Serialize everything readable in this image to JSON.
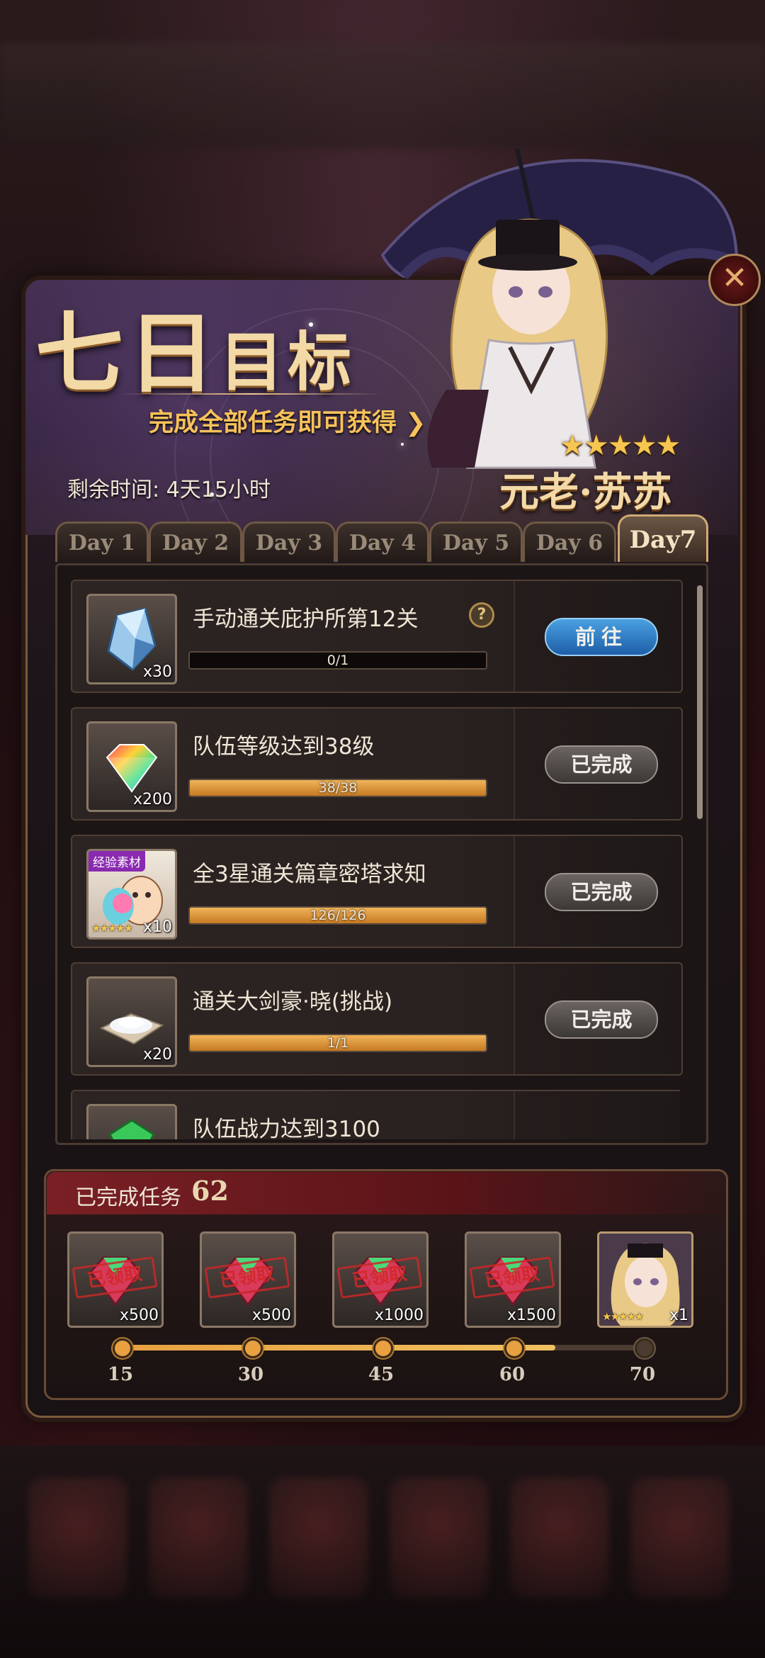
{
  "header": {
    "title_big": "七日",
    "title_small": "目标",
    "subtitle": "完成全部任务即可获得 ❯",
    "remaining_time": "剩余时间: 4天15小时",
    "hero_stars": "★★★★★",
    "hero_name": "元老·苏苏",
    "close_icon": "✕"
  },
  "tabs": [
    {
      "label": "Day 1",
      "active": false
    },
    {
      "label": "Day 2",
      "active": false
    },
    {
      "label": "Day 3",
      "active": false
    },
    {
      "label": "Day 4",
      "active": false
    },
    {
      "label": "Day 5",
      "active": false
    },
    {
      "label": "Day 6",
      "active": false
    },
    {
      "label": "Day7",
      "active": true
    }
  ],
  "tasks": [
    {
      "icon": "blue-crystal-icon",
      "qty": "x30",
      "title": "手动通关庇护所第12关",
      "has_help": true,
      "help": "?",
      "progress_text": "0/1",
      "progress": 0.0,
      "button": "前往",
      "button_type": "go"
    },
    {
      "icon": "rainbow-gem-icon",
      "qty": "x200",
      "title": "队伍等级达到38级",
      "progress_text": "38/38",
      "progress": 1.0,
      "button": "已完成",
      "button_type": "done"
    },
    {
      "icon": "exp-material-icon",
      "badge": "经验素材",
      "stars": "★★★★★",
      "qty": "x10",
      "title": "全3星通关篇章密塔求知",
      "progress_text": "126/126",
      "progress": 1.0,
      "button": "已完成",
      "button_type": "done"
    },
    {
      "icon": "white-powder-icon",
      "qty": "x20",
      "title": "通关大剑豪·晓(挑战)",
      "progress_text": "1/1",
      "progress": 1.0,
      "button": "已完成",
      "button_type": "done"
    },
    {
      "icon": "green-gem-icon",
      "qty": "",
      "title": "队伍战力达到3100",
      "progress_text": "",
      "progress": 0.0,
      "button": "",
      "button_type": "partial"
    }
  ],
  "completed": {
    "label": "已完成任务",
    "count": "62",
    "rewards": [
      {
        "icon": "red-gem-icon",
        "qty": "x500",
        "stamp": "已领取",
        "milestone": "15"
      },
      {
        "icon": "red-gem-icon",
        "qty": "x500",
        "stamp": "已领取",
        "milestone": "30"
      },
      {
        "icon": "red-gem-icon",
        "qty": "x1000",
        "stamp": "已领取",
        "milestone": "45"
      },
      {
        "icon": "red-gem-icon",
        "qty": "x1500",
        "stamp": "已领取",
        "milestone": "60"
      },
      {
        "icon": "hero-portrait-icon",
        "qty": "x1",
        "stars": "★★★★★",
        "milestone": "70"
      }
    ],
    "progress": 0.83
  },
  "colors": {
    "accent_gold": "#f3d9a6",
    "go_button": "#2a72c0",
    "done_button": "#5a5452",
    "progress": "#e8a040"
  }
}
